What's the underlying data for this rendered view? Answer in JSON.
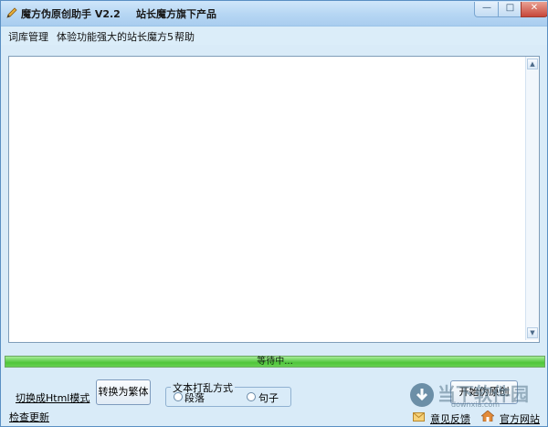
{
  "window": {
    "title": "魔方伪原创助手  V2.2",
    "slogan": "站长魔方旗下产品",
    "controls": {
      "minimize": "—",
      "maximize": "□",
      "close": "✕"
    }
  },
  "menu": {
    "items": [
      {
        "label": "词库管理"
      },
      {
        "label": "体验功能强大的站长魔方5"
      },
      {
        "label": "帮助"
      }
    ]
  },
  "editor": {
    "content": ""
  },
  "progress": {
    "status": "等待中...",
    "percent": 100
  },
  "bottom": {
    "switch_html_link": "切换成Html模式",
    "check_update_link": "检查更新",
    "convert_button": "转换为繁体",
    "shuffle_group": {
      "legend": "文本打乱方式",
      "options": [
        {
          "label": "段落"
        },
        {
          "label": "句子"
        }
      ]
    },
    "start_button": "开始伪原创",
    "feedback_link": "意见反馈",
    "website_link": "官方网站",
    "watermark": {
      "text": "当下软件园",
      "sub": "downxia.com"
    }
  }
}
